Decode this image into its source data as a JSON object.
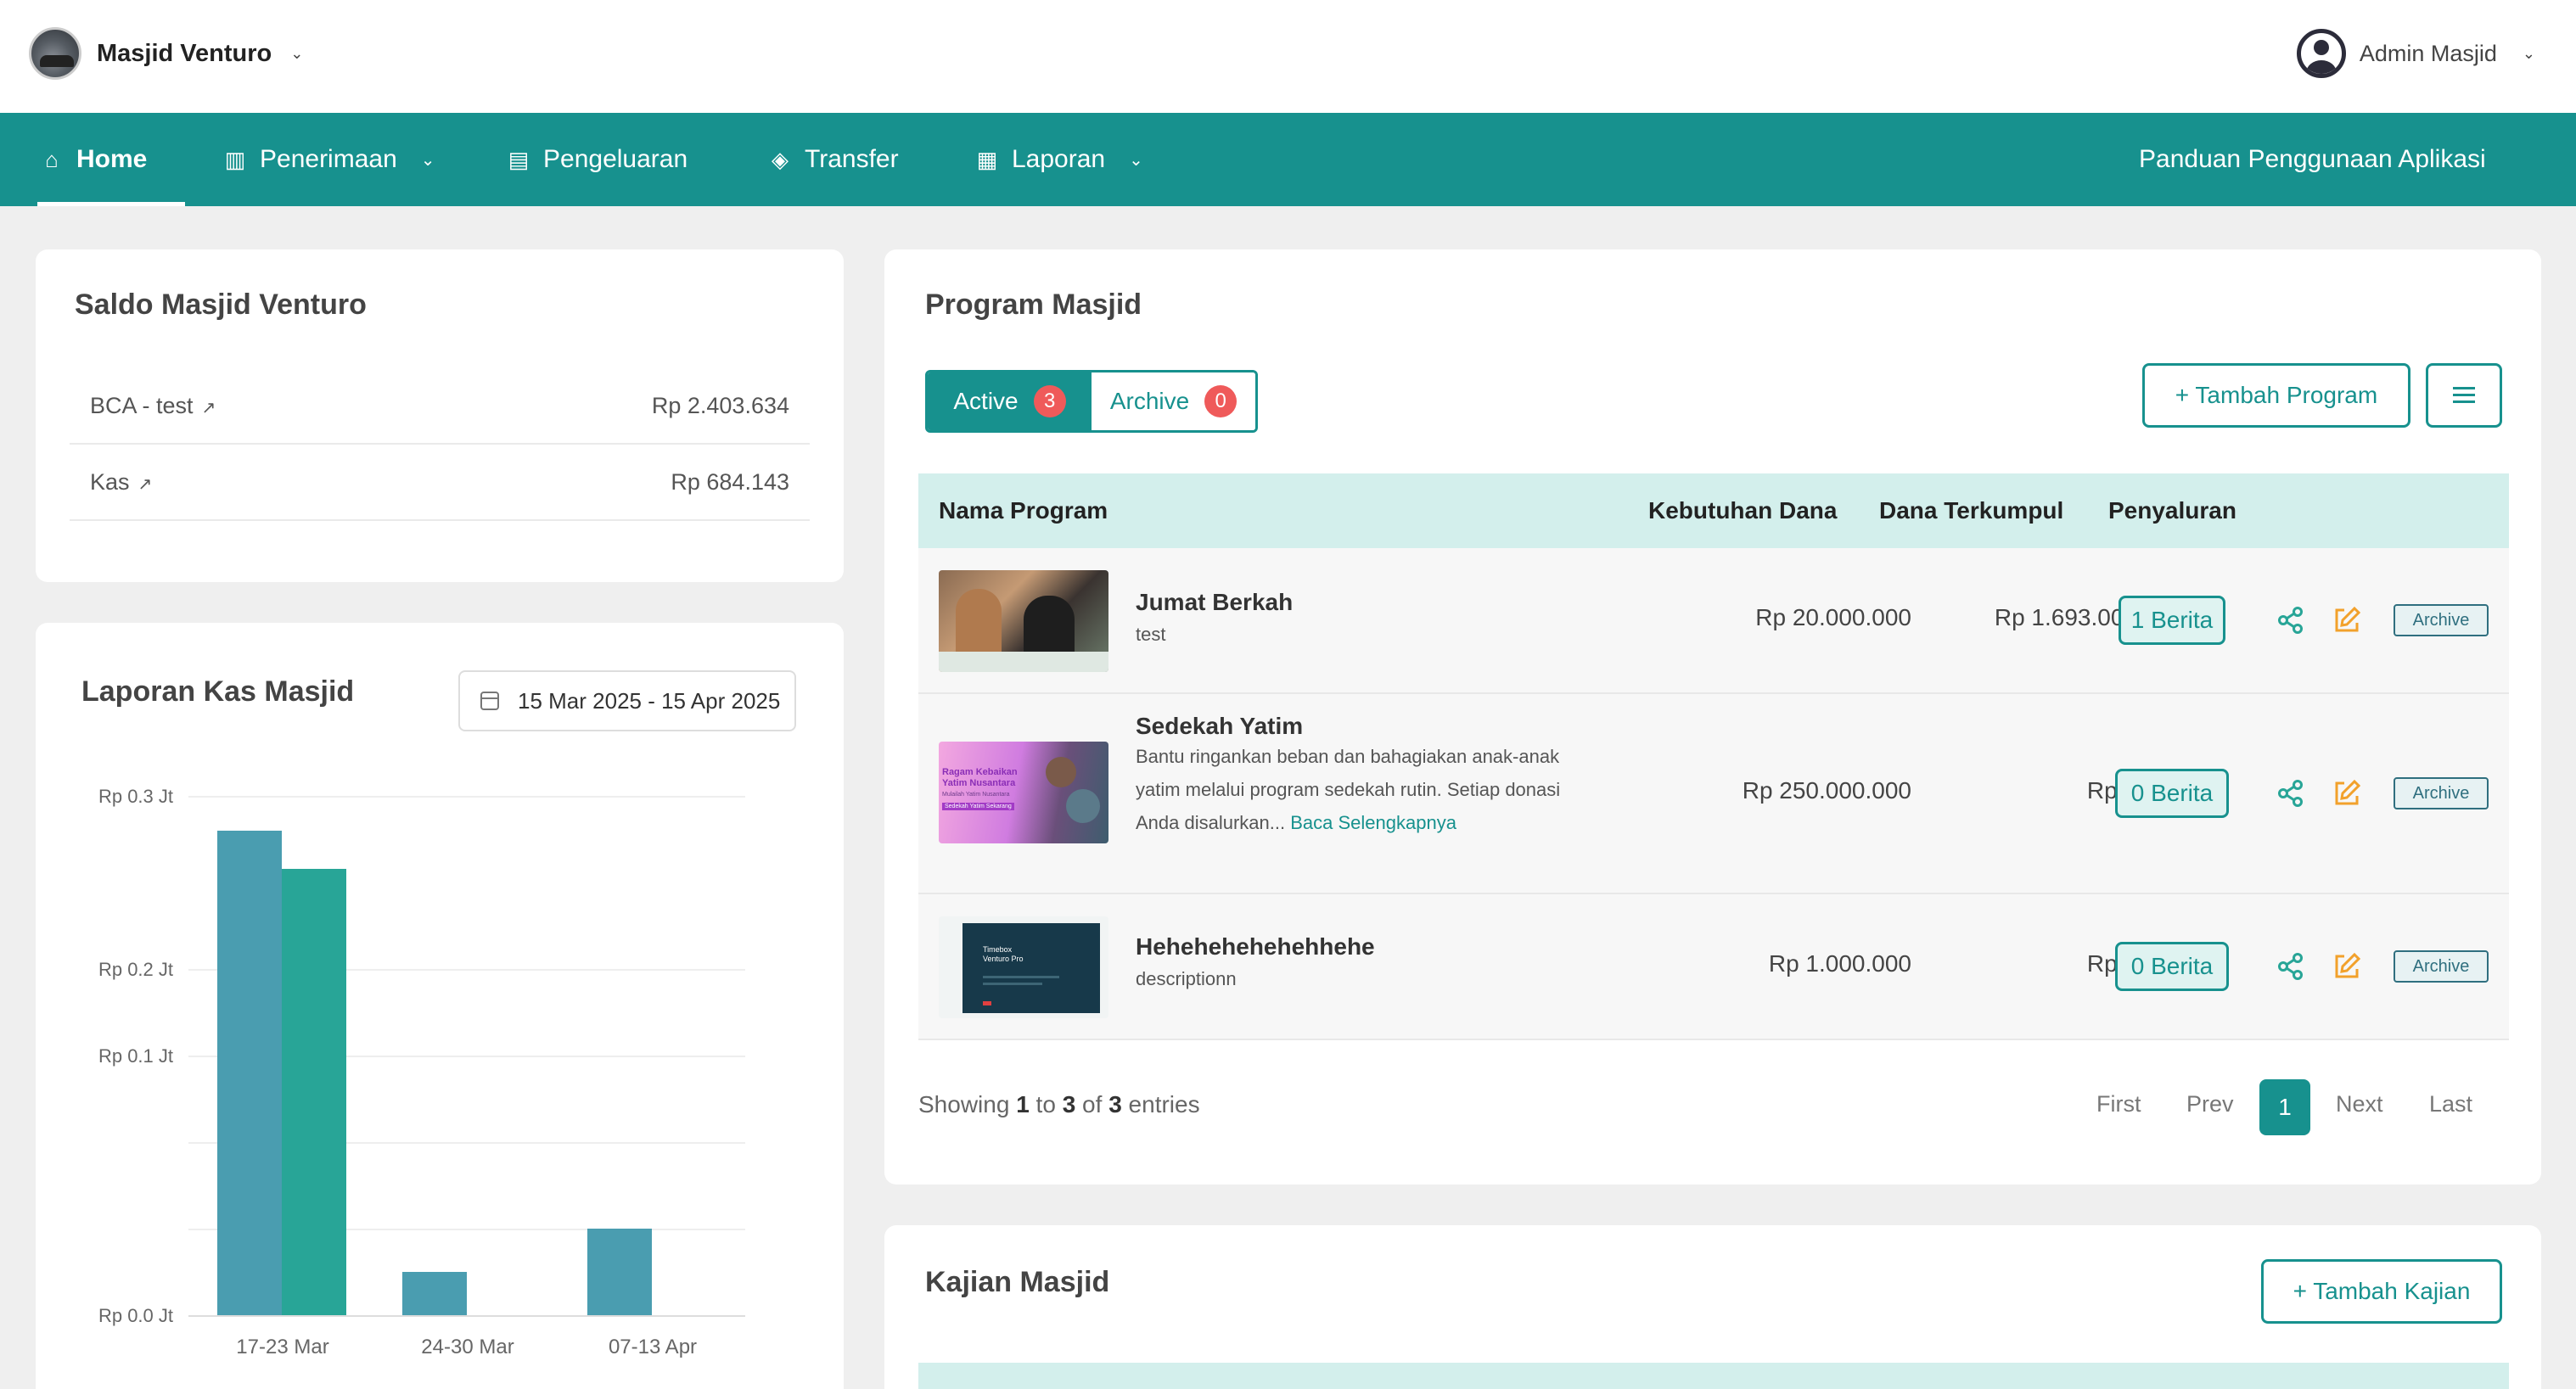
{
  "header": {
    "mosque_name": "Masjid Venturo",
    "user_name": "Admin Masjid"
  },
  "nav": {
    "items": [
      {
        "label": "Home",
        "icon": "home-icon"
      },
      {
        "label": "Penerimaan",
        "icon": "bar-chart-icon"
      },
      {
        "label": "Pengeluaran",
        "icon": "chart-box-icon"
      },
      {
        "label": "Transfer",
        "icon": "tag-icon"
      },
      {
        "label": "Laporan",
        "icon": "document-icon"
      }
    ],
    "guide_label": "Panduan Penggunaan Aplikasi"
  },
  "saldo": {
    "title": "Saldo Masjid Venturo",
    "accounts": [
      {
        "name": "BCA - test",
        "amount": "Rp 2.403.634"
      },
      {
        "name": "Kas",
        "amount": "Rp 684.143"
      }
    ]
  },
  "laporan": {
    "title": "Laporan Kas Masjid",
    "date_range": "15 Mar 2025 - 15 Apr 2025"
  },
  "chart_data": {
    "type": "bar",
    "categories": [
      "17-23 Mar",
      "24-30 Mar",
      "07-13 Apr"
    ],
    "series": [
      {
        "values": [
          0.28,
          0.025,
          0.05
        ],
        "color": "#4a9db0"
      },
      {
        "values": [
          0.258,
          0,
          0
        ],
        "color": "#28a597"
      }
    ],
    "yticks": [
      "Rp 0.3 Jt",
      "Rp 0.2 Jt",
      "Rp 0.1 Jt",
      "Rp 0.0 Jt"
    ],
    "ylim": [
      0,
      0.3
    ],
    "unit": "Jt"
  },
  "program": {
    "title": "Program Masjid",
    "tab_active": "Active",
    "tab_active_count": "3",
    "tab_archive": "Archive",
    "tab_archive_count": "0",
    "add_label": "+ Tambah Program",
    "columns": [
      "Nama Program",
      "Kebutuhan Dana",
      "Dana Terkumpul",
      "Penyaluran"
    ],
    "rows": [
      {
        "name": "Jumat Berkah",
        "desc": "test",
        "need": "Rp 20.000.000",
        "collected": "Rp 1.693.000",
        "news": "1 Berita",
        "archive": "Archive"
      },
      {
        "name": "Sedekah Yatim",
        "desc": "Bantu ringankan beban dan bahagiakan anak-anak yatim melalui program sedekah rutin. Setiap donasi Anda disalurkan...",
        "more": "Baca Selengkapnya",
        "need": "Rp 250.000.000",
        "collected": "Rp 0",
        "news": "0 Berita",
        "archive": "Archive",
        "thumb_text": [
          "Ragam Kebaikan",
          "Yatim Nusantara",
          "Mulailah Yatim Nusantara",
          "Sedekah Yatim Sekarang"
        ]
      },
      {
        "name": "Hehehehehehehhehe",
        "desc": "descriptionn",
        "need": "Rp 1.000.000",
        "collected": "Rp 0",
        "news": "0 Berita",
        "archive": "Archive",
        "thumb_text": [
          "Timebox",
          "Venturo Pro"
        ]
      }
    ],
    "showing": {
      "prefix": "Showing",
      "from": "1",
      "to_word": "to",
      "to": "3",
      "of_word": "of",
      "total": "3",
      "suffix": "entries"
    },
    "pager": {
      "first": "First",
      "prev": "Prev",
      "current": "1",
      "next": "Next",
      "last": "Last"
    }
  },
  "kajian": {
    "title": "Kajian Masjid",
    "add_label": "+ Tambah Kajian"
  }
}
